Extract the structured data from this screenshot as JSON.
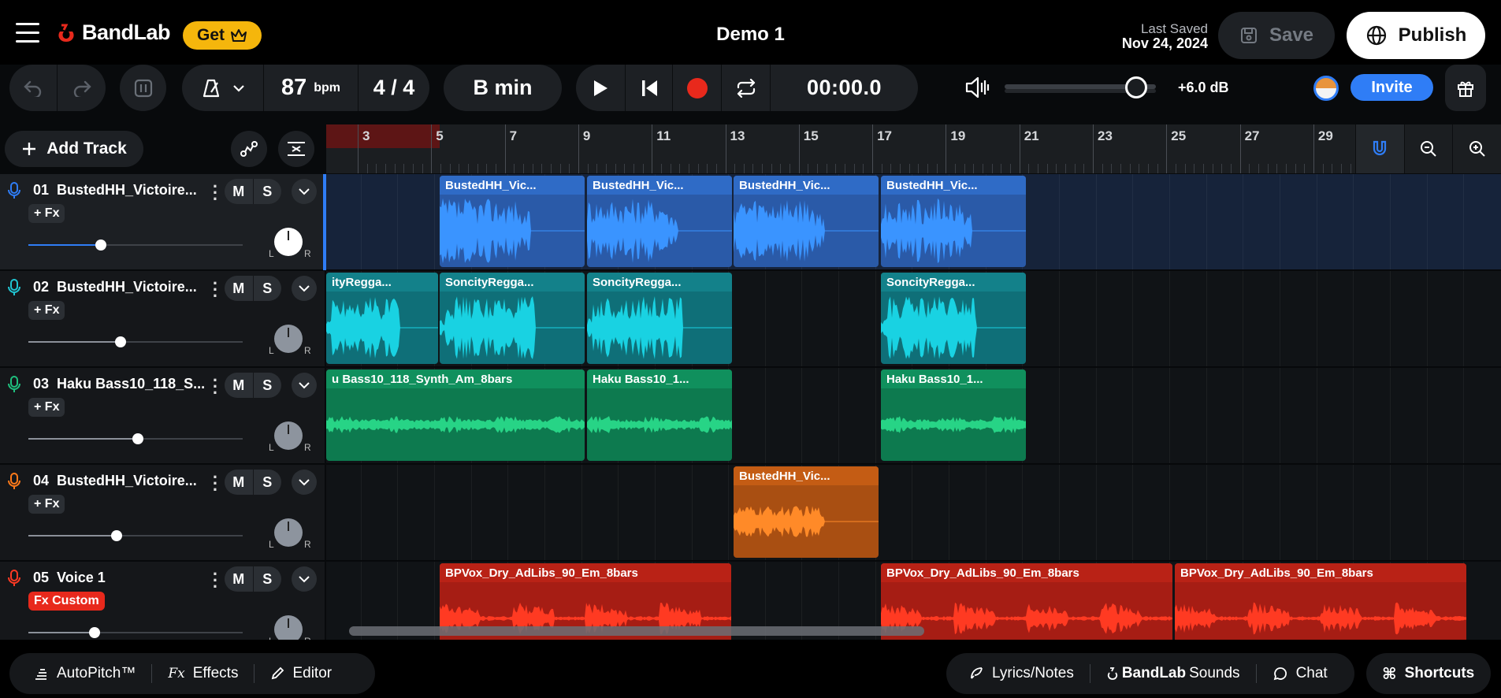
{
  "header": {
    "brand": "BandLab",
    "get_label": "Get",
    "project_title": "Demo 1",
    "last_saved_label": "Last Saved",
    "last_saved_date": "Nov 24, 2024",
    "save_label": "Save",
    "publish_label": "Publish"
  },
  "toolbar": {
    "bpm_value": "87",
    "bpm_unit": "bpm",
    "time_signature": "4 / 4",
    "key": "B min",
    "time_display": "00:00.0",
    "volume_db": "+6.0 dB",
    "volume_level": 0.8,
    "invite_label": "Invite"
  },
  "track_controls": {
    "add_track_label": "Add Track"
  },
  "ruler": {
    "bars": [
      "3",
      "5",
      "7",
      "9",
      "11",
      "13",
      "15",
      "17",
      "19",
      "21",
      "23",
      "25",
      "27",
      "29"
    ]
  },
  "tracks": [
    {
      "number": "01",
      "name": "BustedHH_Victoire...",
      "fx": "+ Fx",
      "mute": "M",
      "solo": "S",
      "color": "#2f7df6",
      "volume": 0.34,
      "pan_l": "L",
      "pan_r": "R"
    },
    {
      "number": "02",
      "name": "BustedHH_Victoire...",
      "fx": "+ Fx",
      "mute": "M",
      "solo": "S",
      "color": "#20c5d2",
      "volume": 0.43,
      "pan_l": "L",
      "pan_r": "R"
    },
    {
      "number": "03",
      "name": "Haku Bass10_118_S...",
      "fx": "+ Fx",
      "mute": "M",
      "solo": "S",
      "color": "#1fc07e",
      "volume": 0.51,
      "pan_l": "L",
      "pan_r": "R"
    },
    {
      "number": "04",
      "name": "BustedHH_Victoire...",
      "fx": "+ Fx",
      "mute": "M",
      "solo": "S",
      "color": "#ff7a1a",
      "volume": 0.41,
      "pan_l": "L",
      "pan_r": "R"
    },
    {
      "number": "05",
      "name": "Voice 1",
      "fx": "Fx Custom",
      "mute": "M",
      "solo": "S",
      "color": "#ff3a24",
      "volume": 0.31,
      "pan_l": "L",
      "pan_r": "R"
    }
  ],
  "clips": {
    "t1": [
      "BustedHH_Vic...",
      "BustedHH_Vic...",
      "BustedHH_Vic...",
      "BustedHH_Vic..."
    ],
    "t2": [
      "ityRegga...",
      "SoncityRegga...",
      "SoncityRegga...",
      "SoncityRegga..."
    ],
    "t3": [
      "u Bass10_118_Synth_Am_8bars",
      "Haku Bass10_1...",
      "Haku Bass10_1..."
    ],
    "t4": [
      "BustedHH_Vic..."
    ],
    "t5": [
      "BPVox_Dry_AdLibs_90_Em_8bars",
      "BPVox_Dry_AdLibs_90_Em_8bars",
      "BPVox_Dry_AdLibs_90_Em_8bars"
    ]
  },
  "footer": {
    "autopitch": "AutoPitch™",
    "effects": "Effects",
    "editor": "Editor",
    "lyrics": "Lyrics/Notes",
    "bandlab": "BandLab",
    "sounds": "Sounds",
    "chat": "Chat",
    "shortcuts": "Shortcuts"
  }
}
